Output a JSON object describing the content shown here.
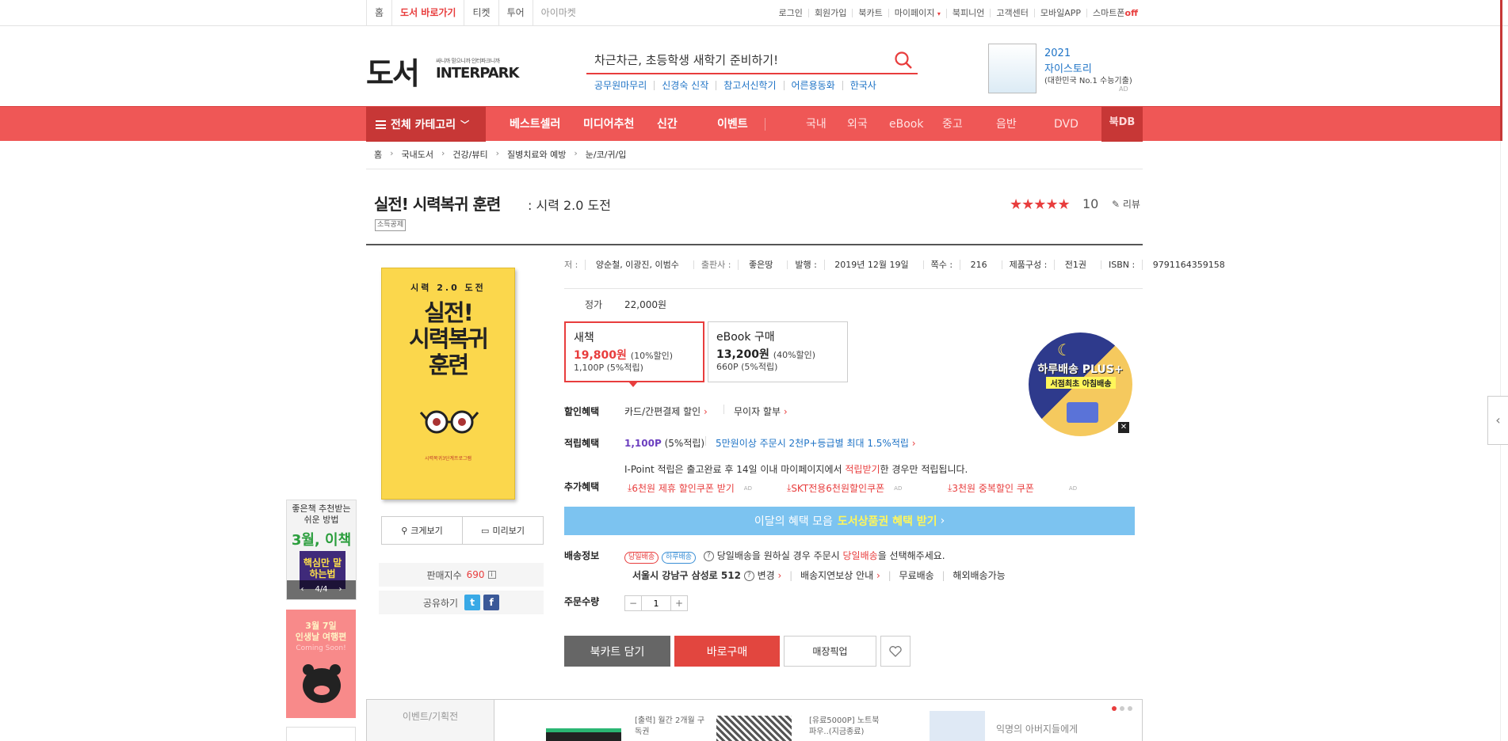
{
  "top_nav": [
    "홈",
    "도서 바로가기",
    "티켓",
    "투어",
    "아이마켓"
  ],
  "util_links": [
    "로그인",
    "회원가입",
    "북카트",
    "마이페이지",
    "북피니언",
    "고객센터",
    "모바일APP",
    "스마트폰"
  ],
  "util_off": "off",
  "logo": {
    "main": "도서",
    "sub": "싸니까 믿으니까 인터파크니까",
    "brand": "INTERPARK"
  },
  "search": {
    "value": "차근차근, 초등학생 새학기 준비하기!"
  },
  "keywords": [
    "공무원마무리",
    "신경숙 신작",
    "참고서신학기",
    "어른용동화",
    "한국사"
  ],
  "header_ad": {
    "title1": "2021",
    "title2": "자이스토리",
    "sub": "(대한민국 No.1 수능기출)",
    "tag": "AD"
  },
  "gnb": {
    "category": "전체 카테고리",
    "items": [
      "베스트셀러",
      "미디어추천",
      "신간",
      "이벤트"
    ],
    "light_items": [
      "국내",
      "외국",
      "eBook",
      "중고",
      "음반",
      "DVD"
    ],
    "bookdb": "북DB"
  },
  "breadcrumb": [
    "홈",
    "국내도서",
    "건강/뷰티",
    "질병치료와 예방",
    "눈/코/귀/입"
  ],
  "product": {
    "title": "실전! 시력복귀 훈련",
    "subtitle": ": 시력 2.0 도전",
    "badge": "소득공제",
    "stars": "★★★★★",
    "score": "10",
    "review": "리뷰"
  },
  "cover": {
    "line1": "시력 2.0 도전",
    "line2": "실전!",
    "line3": "시력복귀",
    "line4": "훈련",
    "foot": "시력복귀3단계프로그램"
  },
  "image_buttons": [
    "크게보기",
    "미리보기"
  ],
  "sales": {
    "label": "판매지수",
    "value": "690"
  },
  "share_label": "공유하기",
  "meta": [
    {
      "k": "저 :",
      "v": "양순철, 이광진, 이범수"
    },
    {
      "k": "출판사 :",
      "v": "좋은땅"
    },
    {
      "k": "발행 :",
      "v": "2019년 12월 19일"
    },
    {
      "k": "쪽수 :",
      "v": "216"
    },
    {
      "k": "제품구성 :",
      "v": "전1권"
    },
    {
      "k": "ISBN :",
      "v": "9791164359158"
    }
  ],
  "price": {
    "label": "정가",
    "value": "22,000원"
  },
  "options": [
    {
      "head": "새책",
      "price": "19,800원",
      "disc": "(10%할인)",
      "point": "1,100P (5%적립)",
      "color": "#e83d3d"
    },
    {
      "head": "eBook 구매",
      "price": "13,200원",
      "disc": "(40%할인)",
      "point": "660P (5%적립)",
      "color": "#222222"
    }
  ],
  "discount": {
    "label": "할인혜택",
    "a": "카드/간편결제 할인",
    "b": "무이자 할부"
  },
  "earn": {
    "label": "적립혜택",
    "points": "1,100P",
    "pct": "(5%적립)",
    "promo": "5만원이상 주문시 2천P+등급별 최대 1.5%적립",
    "note_pre": "I-Point 적립은 출고완료 후 14일 이내 마이페이지에서 ",
    "note_red": "적립받기",
    "note_post": "한 경우만 적립됩니다."
  },
  "extra": {
    "label": "추가혜택",
    "coupons": [
      "6천원 제휴 할인쿠폰 받기",
      "SKT전용6천원할인쿠폰",
      "3천원 중복할인 쿠폰"
    ],
    "ad": "AD"
  },
  "banner": {
    "pre": "이달의 혜택 모음",
    "highlight": "도서상품권 혜택 받기"
  },
  "shipping": {
    "label": "배송정보",
    "pill1": "당일배송",
    "pill2": "하루배송",
    "msg_pre": "당일배송을 원하실 경우 주문시 ",
    "msg_red": "당일배송",
    "msg_post": "을 선택해주세요.",
    "address": "서울시 강남구 삼성로 512",
    "change": "변경",
    "delay": "배송지연보상 안내",
    "free": "무료배송",
    "overseas": "해외배송가능"
  },
  "quantity": {
    "label": "주문수량",
    "value": "1"
  },
  "buttons": {
    "cart": "북카트 담기",
    "buy": "바로구매",
    "store": "매장픽업"
  },
  "circle_ad": {
    "title": "하루배송 PLUS+",
    "sub": "서점최초 아침배송"
  },
  "side_ad1": {
    "line1": "좋은책 추천받는",
    "line2": "쉬운 방법",
    "big": "3월, 이책",
    "book": "핵심만 말하는법",
    "page": "4/4"
  },
  "side_ad2": {
    "line1": "3월 7일",
    "line2": "인생날 여행편",
    "sub": "Coming Soon!"
  },
  "bottom": {
    "tab": "이벤트/기획전",
    "item1": "[출력] 월간 2개월 구독권",
    "item2": "[유료5000P] 노트북 파우..(지금종료)",
    "item3": "익명의 아버지들에게"
  },
  "colors": {
    "accent": "#e83d3d",
    "gnb": "#ef5756",
    "banner": "#7cc3f0"
  }
}
